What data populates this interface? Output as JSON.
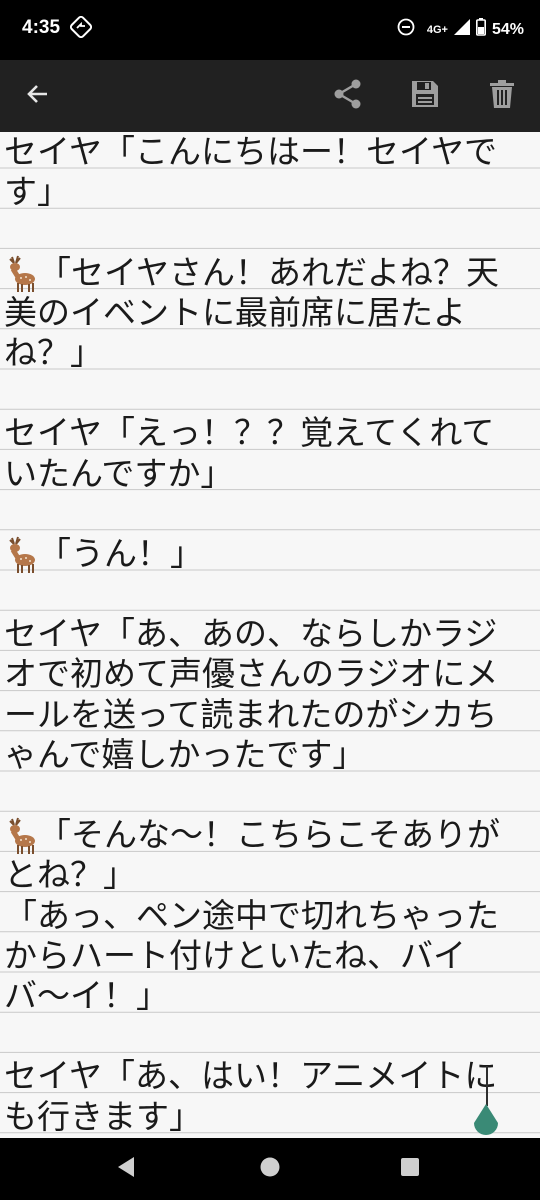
{
  "status_bar": {
    "time": "4:35",
    "network": "4G+",
    "battery": "54%"
  },
  "toolbar": {
    "back_icon": "arrow-left-icon",
    "share_icon": "share-icon",
    "save_icon": "floppy-disk-icon",
    "delete_icon": "trash-icon"
  },
  "editor": {
    "lines": [
      "セイヤ「こんにちはー！セイヤで",
      "す」",
      "",
      "「セイヤさん！あれだよね？天",
      "美のイベントに最前席に居たよ",
      "ね？」",
      "",
      "セイヤ「えっ！？？覚えてくれて",
      "いたんですか」",
      "",
      "「うん！」",
      "",
      "セイヤ「あ、あの、ならしかラジ",
      "オで初めて声優さんのラジオにメ",
      "ールを送って読まれたのがシカち",
      "ゃんで嬉しかったです」",
      "",
      "「そんな〜！こちらこそありが",
      "とね？」",
      "「あっ、ペン途中で切れちゃった",
      "からハート付けといたね、バイ",
      "バ〜イ！」",
      "",
      "セイヤ「あ、はい！アニメイト",
      "に",
      "も行きます」"
    ]
  },
  "colors": {
    "app_bar": "#212121",
    "background": "#f7f7f7",
    "cursor_handle": "#3a8a76"
  },
  "nav_bar": {
    "back_icon": "triangle-back-icon",
    "home_icon": "circle-home-icon",
    "recents_icon": "square-recents-icon"
  }
}
